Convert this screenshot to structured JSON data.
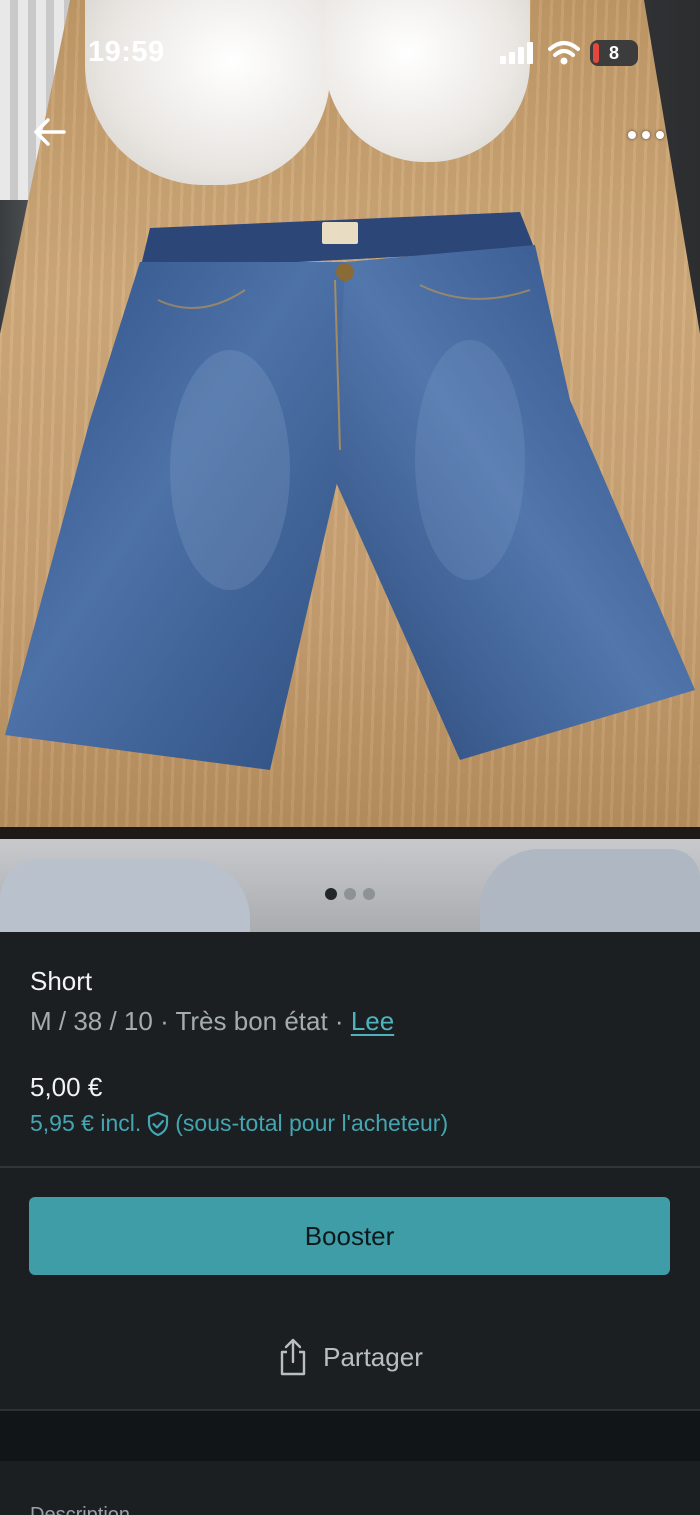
{
  "status_bar": {
    "time": "19:59",
    "battery": "8",
    "icons": [
      "signal-icon",
      "wifi-icon",
      "battery-icon"
    ]
  },
  "header": {
    "back_icon": "arrow-left",
    "more_icon": "more-horizontal"
  },
  "gallery": {
    "image_description": "photo",
    "page_count": 3,
    "active_index": 0
  },
  "item": {
    "title": "Short",
    "meta_prefix": "M / 38 / 10 · Très bon état · ",
    "brand": "Lee",
    "price": "5,00 €",
    "price_incl": "5,95 € incl.",
    "price_incl_note": "(sous-total pour l'acheteur)"
  },
  "actions": {
    "booster_label": "Booster",
    "share_label": "Partager"
  },
  "section": {
    "description_label": "Description"
  },
  "colors": {
    "accent": "#3f9da8",
    "link": "#4fb3bd",
    "background": "#1b1f21"
  }
}
